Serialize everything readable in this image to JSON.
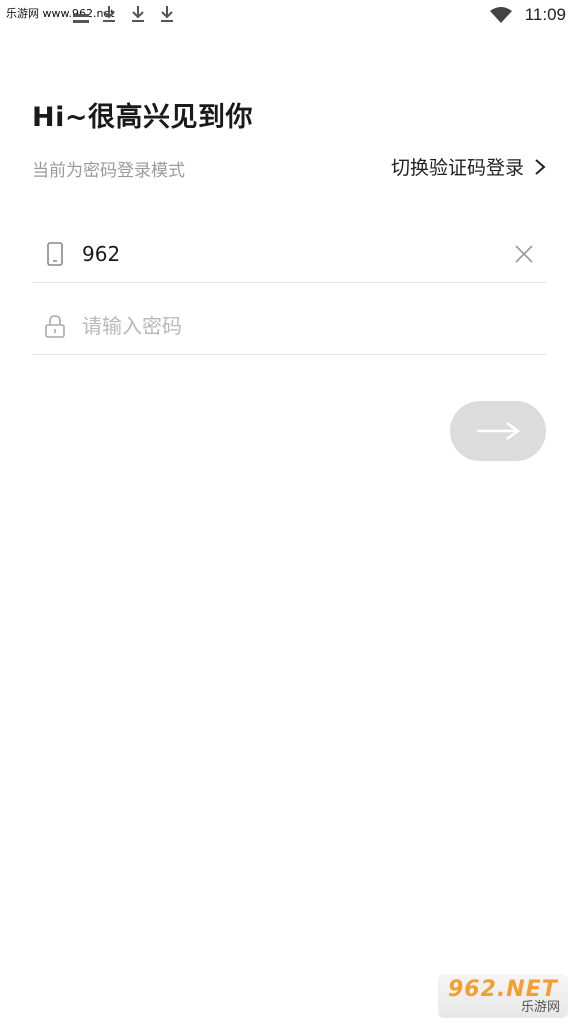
{
  "status_bar": {
    "watermark_text": "乐游网 www.962.net",
    "time": "11:09",
    "icons": [
      "notification-icon",
      "download-icon",
      "download-icon",
      "download-icon",
      "wifi-icon"
    ]
  },
  "header": {
    "title": "Hi~很高兴见到你",
    "mode_text": "当前为密码登录模式",
    "switch_label": "切换验证码登录"
  },
  "form": {
    "phone": {
      "value": "962",
      "icon": "phone-icon"
    },
    "password": {
      "value": "",
      "placeholder": "请输入密码",
      "icon": "lock-icon"
    },
    "submit_icon": "arrow-right-icon"
  },
  "watermark": {
    "top": "962.NET",
    "bottom": "乐游网"
  },
  "colors": {
    "text_primary": "#1a1a1a",
    "text_secondary": "#9a9a9a",
    "placeholder": "#b8b8b8",
    "divider": "#e3e3e3",
    "button_disabled": "#dcdcdc",
    "watermark_orange": "#f19a28"
  }
}
